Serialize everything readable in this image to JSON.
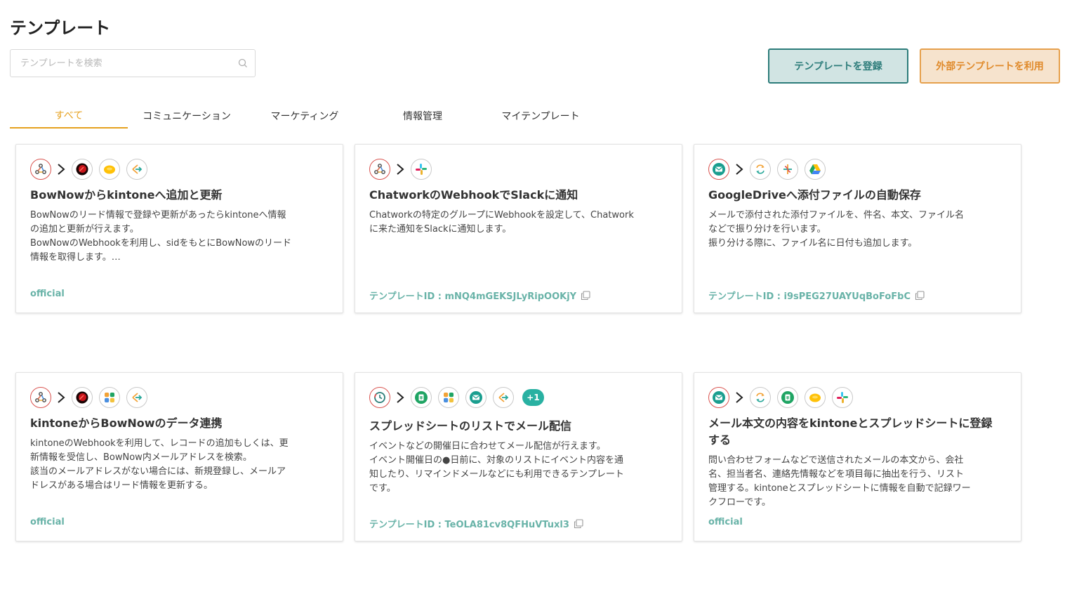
{
  "page": {
    "title": "テンプレート"
  },
  "search": {
    "placeholder": "テンプレートを検索",
    "value": ""
  },
  "buttons": {
    "register": "テンプレートを登録",
    "external": "外部テンプレートを利用"
  },
  "tabs": [
    {
      "label": "すべて",
      "active": true
    },
    {
      "label": "コミュニケーション",
      "active": false
    },
    {
      "label": "マーケティング",
      "active": false
    },
    {
      "label": "情報管理",
      "active": false
    },
    {
      "label": "マイテンプレート",
      "active": false
    }
  ],
  "cards": [
    {
      "title": "BowNowからkintoneへ追加と更新",
      "description": "BowNowのリード情報で登録や更新があったらkintoneへ情報\nの追加と更新が行えます。\nBowNowのWebhookを利用し、sidをもとにBowNowのリード\n情報を取得します。…",
      "footer": "official",
      "icons": [
        "webhook-icon",
        "bownow-icon",
        "kintone-icon",
        "transform-icon"
      ]
    },
    {
      "title": "ChatworkのWebhookでSlackに通知",
      "description": "Chatworkの特定のグループにWebhookを設定して、Chatwork\nに来た通知をSlackに通知します。",
      "footer": "テンプレートID : mNQ4mGEKSJLyRipOOKjY",
      "icons": [
        "webhook-icon",
        "slack-icon"
      ]
    },
    {
      "title": "GoogleDriveへ添付ファイルの自動保存",
      "description": "メールで添付された添付ファイルを、件名、本文、ファイル名\nなどで振り分けを行います。\n振り分ける際に、ファイル名に日付も追加します。",
      "footer": "テンプレートID : i9sPEG27UAYUqBoFoFbC",
      "icons": [
        "mail-icon",
        "loop-icon",
        "branch-icon",
        "google-drive-icon"
      ]
    },
    {
      "title": "kintoneからBowNowのデータ連携",
      "description": "kintoneのWebhookを利用して、レコードの追加もしくは、更\n新情報を受信し、BowNow内メールアドレスを検索。\n該当のメールアドレスがない場合には、新規登録し、メールア\nドレスがある場合はリード情報を更新する。",
      "footer": "official",
      "icons": [
        "webhook-icon",
        "bownow-icon",
        "apps-grid-icon",
        "transform-icon"
      ]
    },
    {
      "title": "スプレッドシートのリストでメール配信",
      "description": "イベントなどの開催日に合わせてメール配信が行えます。\nイベント開催日の●日前に、対象のリストにイベント内容を通\n知したり、リマインドメールなどにも利用できるテンプレート\nです。",
      "footer": "テンプレートID : TeOLA81cv8QFHuVTuxl3",
      "icons": [
        "schedule-icon",
        "spreadsheet-icon",
        "apps-grid-icon",
        "mail-icon",
        "transform-icon"
      ],
      "extra_count": "+1"
    },
    {
      "title": "メール本文の内容をkintoneとスプレッドシートに登録する",
      "description": "問い合わせフォームなどで送信されたメールの本文から、会社\n名、担当者名、連絡先情報などを項目毎に抽出を行う、リスト\n管理する。kintoneとスプレッドシートに情報を自動で記録ワー\nクフローです。",
      "footer": "official",
      "icons": [
        "mail-icon",
        "loop-icon",
        "spreadsheet-icon",
        "kintone-icon",
        "slack-icon"
      ]
    }
  ]
}
